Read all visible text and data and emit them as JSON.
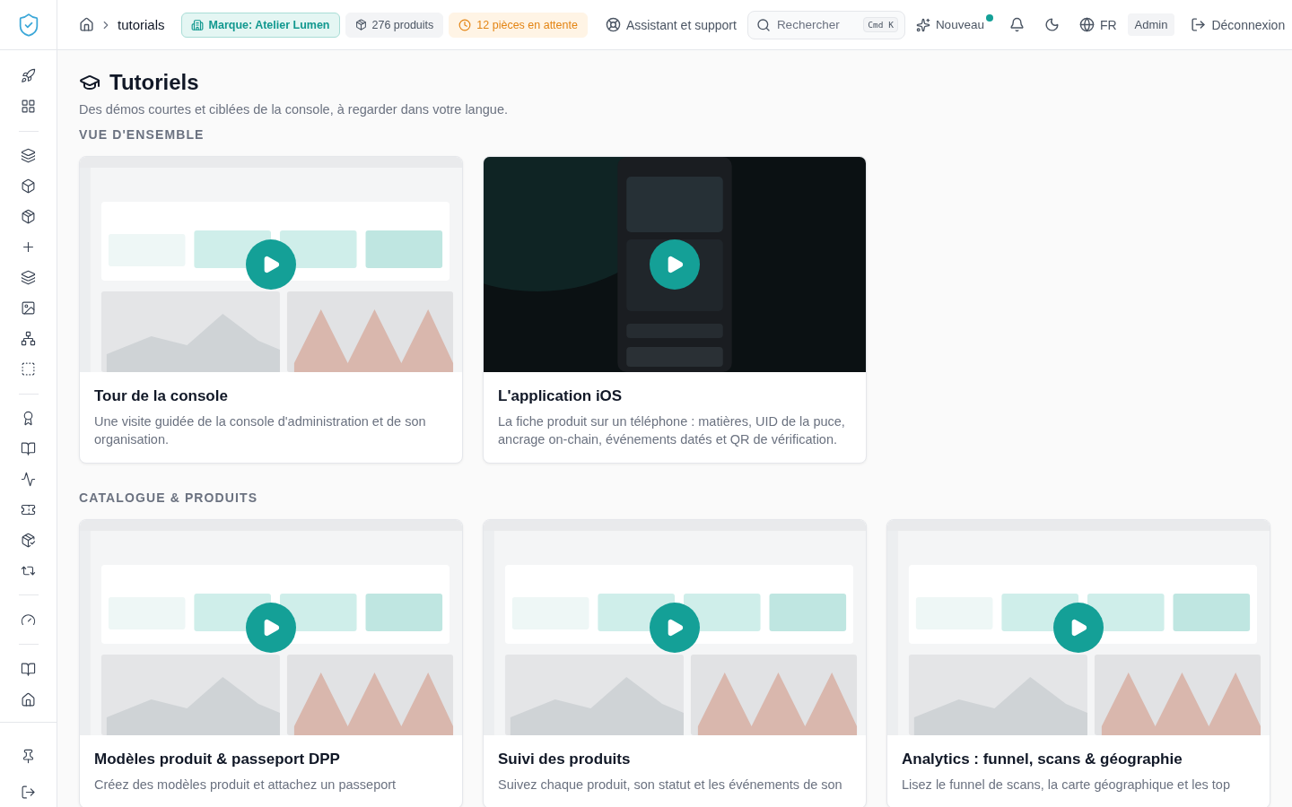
{
  "breadcrumb": {
    "current": "tutorials"
  },
  "topbar": {
    "brand_badge": "Marque: Atelier Lumen",
    "products_badge": "276 produits",
    "pending_badge": "12 pièces en attente",
    "support": "Assistant et support",
    "search": {
      "placeholder": "Rechercher",
      "shortcut": "Cmd K"
    },
    "new": {
      "label": "Nouveau",
      "has_dot": true
    },
    "language": "FR",
    "role": "Admin",
    "logout": "Déconnexion"
  },
  "page": {
    "title": "Tutoriels",
    "subtitle": "Des démos courtes et ciblées de la console, à regarder dans votre langue."
  },
  "sections": [
    {
      "heading": "VUE D'ENSEMBLE",
      "cards": [
        {
          "title": "Tour de la console",
          "description": "Une visite guidée de la console d'administration et de son organisation."
        },
        {
          "title": "L'application iOS",
          "description": "La fiche produit sur un téléphone : matières, UID de la puce, ancrage on-chain, événements datés et QR de vérification."
        }
      ]
    },
    {
      "heading": "CATALOGUE & PRODUITS",
      "cards": [
        {
          "title": "Modèles produit & passeport DPP",
          "description": "Créez des modèles produit et attachez un passeport"
        },
        {
          "title": "Suivi des produits",
          "description": "Suivez chaque produit, son statut et les événements de son"
        },
        {
          "title": "Analytics : funnel, scans & géographie",
          "description": "Lisez le funnel de scans, la carte géographique et les top"
        }
      ]
    }
  ]
}
